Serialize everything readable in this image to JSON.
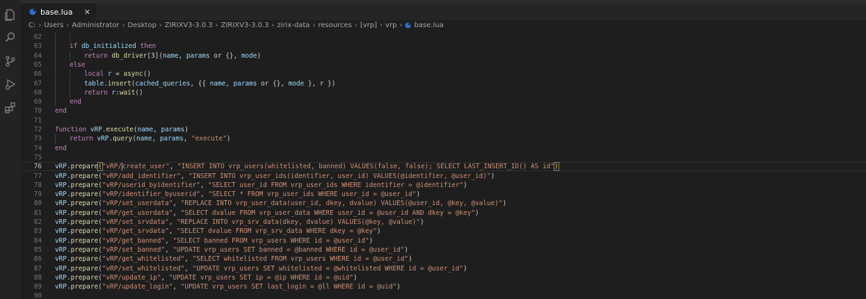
{
  "tab": {
    "filename": "base.lua",
    "close": "✕"
  },
  "breadcrumb": [
    "C:",
    "Users",
    "Administrator",
    "Desktop",
    "ZIRIXV3-3.0.3",
    "ZIRIXV3-3.0.3",
    "zirix-data",
    "resources",
    "[vrp]",
    "vrp"
  ],
  "breadcrumb_file": "base.lua",
  "icons": [
    "files-icon",
    "search-icon",
    "source-control-icon",
    "run-debug-icon",
    "extensions-icon"
  ],
  "colors": {
    "keyword": "#c586c0",
    "function": "#dcdcaa",
    "identifier": "#9cdcfe",
    "string": "#ce9178",
    "plain": "#d4d4d4"
  },
  "current_line": 76,
  "lines": [
    {
      "n": "62",
      "indent": 2,
      "t": []
    },
    {
      "n": "63",
      "indent": 1,
      "t": [
        [
          "kw",
          "if "
        ],
        [
          "id",
          "db_initialized"
        ],
        [
          "kw",
          " then"
        ]
      ]
    },
    {
      "n": "64",
      "indent": 2,
      "t": [
        [
          "kw",
          "return "
        ],
        [
          "fn",
          "db_driver"
        ],
        [
          "pl",
          "["
        ],
        [
          "pl",
          "3"
        ],
        [
          "pl",
          "]("
        ],
        [
          "id",
          "name"
        ],
        [
          "pl",
          ", "
        ],
        [
          "id",
          "params"
        ],
        [
          "pl",
          " or "
        ],
        [
          "pl",
          "{}"
        ],
        [
          "pl",
          ", "
        ],
        [
          "id",
          "mode"
        ],
        [
          "pl",
          ")"
        ]
      ]
    },
    {
      "n": "65",
      "indent": 1,
      "t": [
        [
          "kw",
          "else"
        ]
      ]
    },
    {
      "n": "66",
      "indent": 2,
      "t": [
        [
          "kw",
          "local "
        ],
        [
          "id",
          "r"
        ],
        [
          "pl",
          " = "
        ],
        [
          "fn",
          "async"
        ],
        [
          "pl",
          "()"
        ]
      ]
    },
    {
      "n": "67",
      "indent": 2,
      "t": [
        [
          "id",
          "table"
        ],
        [
          "pl",
          "."
        ],
        [
          "fn",
          "insert"
        ],
        [
          "pl",
          "("
        ],
        [
          "id",
          "cached_queries"
        ],
        [
          "pl",
          ", {{ "
        ],
        [
          "id",
          "name"
        ],
        [
          "pl",
          ", "
        ],
        [
          "id",
          "params"
        ],
        [
          "pl",
          " or {}, "
        ],
        [
          "id",
          "mode"
        ],
        [
          "pl",
          " }, "
        ],
        [
          "id",
          "r"
        ],
        [
          "pl",
          " })"
        ]
      ]
    },
    {
      "n": "68",
      "indent": 2,
      "t": [
        [
          "kw",
          "return "
        ],
        [
          "id",
          "r"
        ],
        [
          "pl",
          ":"
        ],
        [
          "fn",
          "wait"
        ],
        [
          "pl",
          "()"
        ]
      ]
    },
    {
      "n": "69",
      "indent": 1,
      "t": [
        [
          "kw",
          "end"
        ]
      ]
    },
    {
      "n": "70",
      "indent": 0,
      "t": [
        [
          "kw",
          "end"
        ]
      ]
    },
    {
      "n": "71",
      "indent": 0,
      "t": []
    },
    {
      "n": "72",
      "indent": 0,
      "t": [
        [
          "kw",
          "function "
        ],
        [
          "id",
          "vRP"
        ],
        [
          "pl",
          "."
        ],
        [
          "fn",
          "execute"
        ],
        [
          "pl",
          "("
        ],
        [
          "id",
          "name"
        ],
        [
          "pl",
          ", "
        ],
        [
          "id",
          "params"
        ],
        [
          "pl",
          ")"
        ]
      ]
    },
    {
      "n": "73",
      "indent": 1,
      "t": [
        [
          "kw",
          "return "
        ],
        [
          "id",
          "vRP"
        ],
        [
          "pl",
          "."
        ],
        [
          "fn",
          "query"
        ],
        [
          "pl",
          "("
        ],
        [
          "id",
          "name"
        ],
        [
          "pl",
          ", "
        ],
        [
          "id",
          "params"
        ],
        [
          "pl",
          ", "
        ],
        [
          "str",
          "\"execute\""
        ],
        [
          "pl",
          ")"
        ]
      ]
    },
    {
      "n": "74",
      "indent": 0,
      "t": [
        [
          "kw",
          "end"
        ]
      ]
    },
    {
      "n": "75",
      "indent": 0,
      "t": []
    },
    {
      "n": "76",
      "indent": 0,
      "t": [
        [
          "id",
          "vRP"
        ],
        [
          "pl",
          "."
        ],
        [
          "fn",
          "prepare"
        ],
        [
          "br",
          "("
        ],
        [
          "str",
          "\"vRP/"
        ],
        [
          "cur",
          ""
        ],
        [
          "str",
          "create_user\""
        ],
        [
          "pl",
          ", "
        ],
        [
          "str",
          "\"INSERT INTO vrp_users(whitelisted, banned) VALUES(false, false); SELECT LAST_INSERT_ID() AS id\""
        ],
        [
          "br",
          ")"
        ]
      ]
    },
    {
      "n": "77",
      "indent": 0,
      "t": [
        [
          "id",
          "vRP"
        ],
        [
          "pl",
          "."
        ],
        [
          "fn",
          "prepare"
        ],
        [
          "pl",
          "("
        ],
        [
          "str",
          "\"vRP/add_identifier\""
        ],
        [
          "pl",
          ", "
        ],
        [
          "str",
          "\"INSERT INTO vrp_user_ids(identifier, user_id) VALUES(@identifier, @user_id)\""
        ],
        [
          "pl",
          ")"
        ]
      ]
    },
    {
      "n": "78",
      "indent": 0,
      "t": [
        [
          "id",
          "vRP"
        ],
        [
          "pl",
          "."
        ],
        [
          "fn",
          "prepare"
        ],
        [
          "pl",
          "("
        ],
        [
          "str",
          "\"vRP/userid_byidentifier\""
        ],
        [
          "pl",
          ", "
        ],
        [
          "str",
          "\"SELECT user_id FROM vrp_user_ids WHERE identifier = @identifier\""
        ],
        [
          "pl",
          ")"
        ]
      ]
    },
    {
      "n": "79",
      "indent": 0,
      "t": [
        [
          "id",
          "vRP"
        ],
        [
          "pl",
          "."
        ],
        [
          "fn",
          "prepare"
        ],
        [
          "pl",
          "("
        ],
        [
          "str",
          "\"vRP/identifier_byuserid\""
        ],
        [
          "pl",
          ", "
        ],
        [
          "str",
          "\"SELECT * FROM vrp_user_ids WHERE user_id = @user_id\""
        ],
        [
          "pl",
          ")"
        ]
      ]
    },
    {
      "n": "80",
      "indent": 0,
      "t": [
        [
          "id",
          "vRP"
        ],
        [
          "pl",
          "."
        ],
        [
          "fn",
          "prepare"
        ],
        [
          "pl",
          "("
        ],
        [
          "str",
          "\"vRP/set_userdata\""
        ],
        [
          "pl",
          ", "
        ],
        [
          "str",
          "\"REPLACE INTO vrp_user_data(user_id, dkey, dvalue) VALUES(@user_id, @key, @value)\""
        ],
        [
          "pl",
          ")"
        ]
      ]
    },
    {
      "n": "81",
      "indent": 0,
      "t": [
        [
          "id",
          "vRP"
        ],
        [
          "pl",
          "."
        ],
        [
          "fn",
          "prepare"
        ],
        [
          "pl",
          "("
        ],
        [
          "str",
          "\"vRP/get_userdata\""
        ],
        [
          "pl",
          ", "
        ],
        [
          "str",
          "\"SELECT dvalue FROM vrp_user_data WHERE user_id = @user_id AND dkey = @key\""
        ],
        [
          "pl",
          ")"
        ]
      ]
    },
    {
      "n": "82",
      "indent": 0,
      "t": [
        [
          "id",
          "vRP"
        ],
        [
          "pl",
          "."
        ],
        [
          "fn",
          "prepare"
        ],
        [
          "pl",
          "("
        ],
        [
          "str",
          "\"vRP/set_srvdata\""
        ],
        [
          "pl",
          ", "
        ],
        [
          "str",
          "\"REPLACE INTO vrp_srv_data(dkey, dvalue) VALUES(@key, @value)\""
        ],
        [
          "pl",
          ")"
        ]
      ]
    },
    {
      "n": "83",
      "indent": 0,
      "t": [
        [
          "id",
          "vRP"
        ],
        [
          "pl",
          "."
        ],
        [
          "fn",
          "prepare"
        ],
        [
          "pl",
          "("
        ],
        [
          "str",
          "\"vRP/get_srvdata\""
        ],
        [
          "pl",
          ", "
        ],
        [
          "str",
          "\"SELECT dvalue FROM vrp_srv_data WHERE dkey = @key\""
        ],
        [
          "pl",
          ")"
        ]
      ]
    },
    {
      "n": "84",
      "indent": 0,
      "t": [
        [
          "id",
          "vRP"
        ],
        [
          "pl",
          "."
        ],
        [
          "fn",
          "prepare"
        ],
        [
          "pl",
          "("
        ],
        [
          "str",
          "\"vRP/get_banned\""
        ],
        [
          "pl",
          ", "
        ],
        [
          "str",
          "\"SELECT banned FROM vrp_users WHERE id = @user_id\""
        ],
        [
          "pl",
          ")"
        ]
      ]
    },
    {
      "n": "85",
      "indent": 0,
      "t": [
        [
          "id",
          "vRP"
        ],
        [
          "pl",
          "."
        ],
        [
          "fn",
          "prepare"
        ],
        [
          "pl",
          "("
        ],
        [
          "str",
          "\"vRP/set_banned\""
        ],
        [
          "pl",
          ", "
        ],
        [
          "str",
          "\"UPDATE vrp_users SET banned = @banned WHERE id = @user_id\""
        ],
        [
          "pl",
          ")"
        ]
      ]
    },
    {
      "n": "86",
      "indent": 0,
      "t": [
        [
          "id",
          "vRP"
        ],
        [
          "pl",
          "."
        ],
        [
          "fn",
          "prepare"
        ],
        [
          "pl",
          "("
        ],
        [
          "str",
          "\"vRP/get_whitelisted\""
        ],
        [
          "pl",
          ", "
        ],
        [
          "str",
          "\"SELECT whitelisted FROM vrp_users WHERE id = @user_id\""
        ],
        [
          "pl",
          ")"
        ]
      ]
    },
    {
      "n": "87",
      "indent": 0,
      "t": [
        [
          "id",
          "vRP"
        ],
        [
          "pl",
          "."
        ],
        [
          "fn",
          "prepare"
        ],
        [
          "pl",
          "("
        ],
        [
          "str",
          "\"vRP/set_whitelisted\""
        ],
        [
          "pl",
          ", "
        ],
        [
          "str",
          "\"UPDATE vrp_users SET whitelisted = @whitelisted WHERE id = @user_id\""
        ],
        [
          "pl",
          ")"
        ]
      ]
    },
    {
      "n": "88",
      "indent": 0,
      "t": [
        [
          "id",
          "vRP"
        ],
        [
          "pl",
          "."
        ],
        [
          "fn",
          "prepare"
        ],
        [
          "pl",
          "("
        ],
        [
          "str",
          "\"vRP/update_ip\""
        ],
        [
          "pl",
          ", "
        ],
        [
          "str",
          "\"UPDATE vrp_users SET ip = @ip WHERE id = @uid\""
        ],
        [
          "pl",
          ")"
        ]
      ]
    },
    {
      "n": "89",
      "indent": 0,
      "t": [
        [
          "id",
          "vRP"
        ],
        [
          "pl",
          "."
        ],
        [
          "fn",
          "prepare"
        ],
        [
          "pl",
          "("
        ],
        [
          "str",
          "\"vRP/update_login\""
        ],
        [
          "pl",
          ", "
        ],
        [
          "str",
          "\"UPDATE vrp_users SET last_login = @ll WHERE id = @uid\""
        ],
        [
          "pl",
          ")"
        ]
      ]
    },
    {
      "n": "90",
      "indent": 0,
      "t": []
    }
  ]
}
